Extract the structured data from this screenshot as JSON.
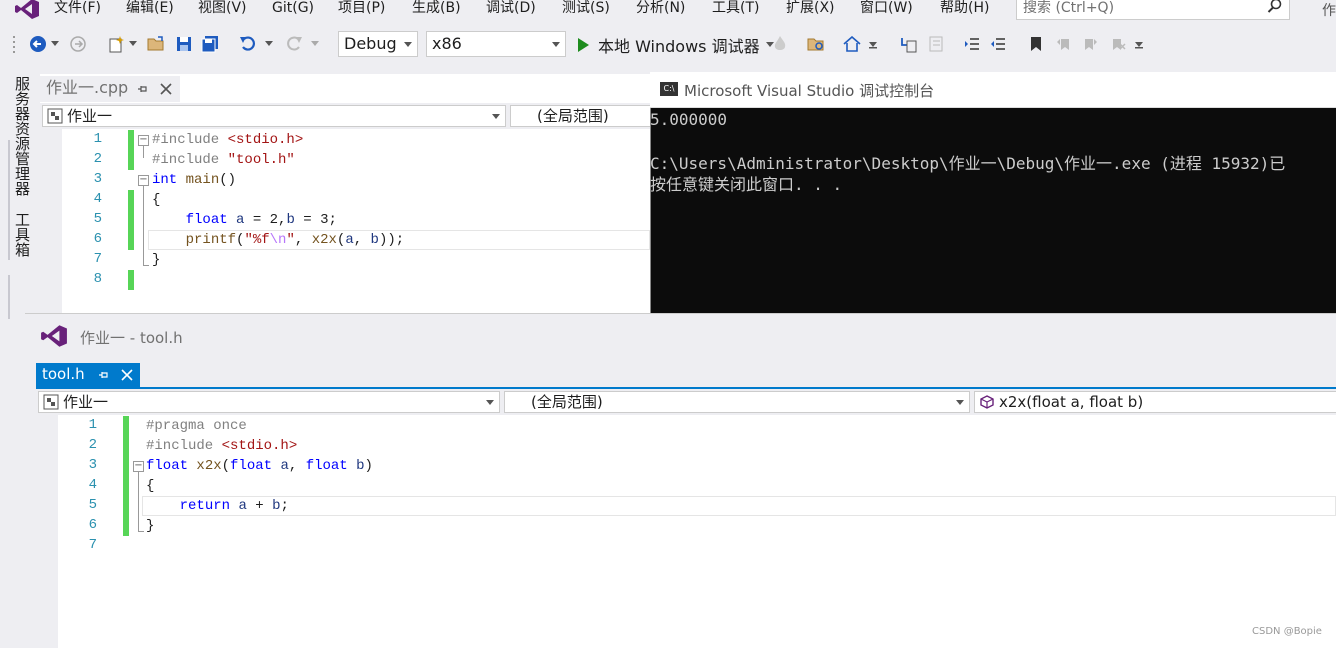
{
  "menu": {
    "items": [
      "文件(F)",
      "编辑(E)",
      "视图(V)",
      "Git(G)",
      "项目(P)",
      "生成(B)",
      "调试(D)",
      "测试(S)",
      "分析(N)",
      "工具(T)",
      "扩展(X)",
      "窗口(W)",
      "帮助(H)"
    ],
    "search_placeholder": "搜索 (Ctrl+Q)",
    "overflow_label": "作"
  },
  "toolbar": {
    "config": "Debug",
    "platform": "x86",
    "run_label": "本地 Windows 调试器"
  },
  "sidebar": {
    "tab1": "服务器资源管理器",
    "tab2": "工具箱"
  },
  "editor1": {
    "tab_title": "作业一.cpp",
    "project_combo": "作业一",
    "scope_combo": "(全局范围)",
    "line_numbers": [
      "1",
      "2",
      "3",
      "4",
      "5",
      "6",
      "7",
      "8"
    ]
  },
  "console": {
    "title": "Microsoft Visual Studio 调试控制台",
    "lines": [
      "5.000000",
      "",
      "C:\\Users\\Administrator\\Desktop\\作业一\\Debug\\作业一.exe (进程 15932)已",
      "按任意键关闭此窗口. . ."
    ]
  },
  "editor2": {
    "window_title": "作业一 - tool.h",
    "tab_title": "tool.h",
    "project_combo": "作业一",
    "scope_combo": "(全局范围)",
    "member_combo": "x2x(float a, float b)",
    "line_numbers": [
      "1",
      "2",
      "3",
      "4",
      "5",
      "6",
      "7"
    ]
  },
  "watermark": "CSDN @Bopie",
  "colors": {
    "accent": "#007acc",
    "changebar": "#57d557",
    "keyword": "#0000ff",
    "string": "#a31515",
    "linenumber": "#2b91af"
  }
}
